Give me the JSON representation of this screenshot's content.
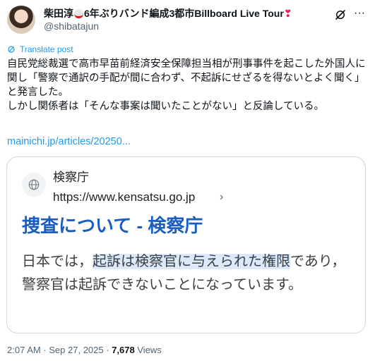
{
  "author": {
    "display_name_prefix": "柴田淳",
    "display_name_suffix": "6年ぶりバンド編成3都市Billboard Live Tour",
    "heart": "❣",
    "handle": "@shibatajun"
  },
  "icons": {
    "avatar": "avatar-photo",
    "grok": "grok-icon",
    "more": "more-icon",
    "translate": "translate-icon",
    "globe": "globe-icon"
  },
  "translate_label": "Translate post",
  "tweet": {
    "paragraph1": "自民党総裁選で高市早苗前経済安全保障担当相が刑事事件を起こした外国人に関し「警察で通訳の手配が間に合わず、不起訴にせざるを得ないとよく聞く」と発言した。",
    "paragraph2": "しかし関係者は「そんな事案は聞いたことがない」と反論している。",
    "link": "mainichi.jp/articles/20250..."
  },
  "card": {
    "site_name": "検察庁",
    "site_url": "https://www.kensatsu.go.jp",
    "chevron": "›",
    "title": "捜査について - 検察庁",
    "snippet_before": "日本では，",
    "snippet_highlight": "起訴は検察官に与えられた権限",
    "snippet_after": "であり，警察官は起訴できないことになっています。"
  },
  "meta": {
    "time": "2:07 AM",
    "separator": " · ",
    "date": "Sep 27, 2025",
    "views_count": "7,678",
    "views_label": " Views"
  },
  "colors": {
    "link": "#1d9bf0",
    "card_title": "#1a5ebf",
    "highlight": "#dce9fb",
    "secondary_text": "#536471"
  }
}
